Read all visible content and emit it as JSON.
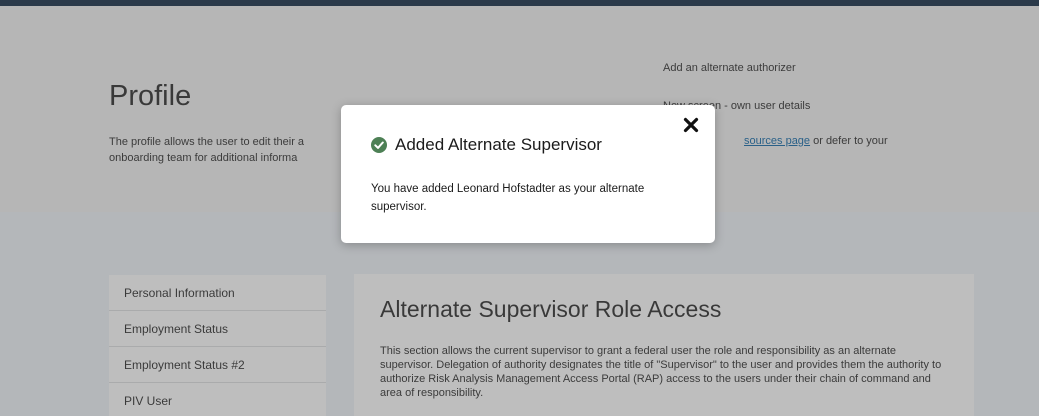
{
  "page": {
    "title": "Profile",
    "description": "The profile allows the user to edit their a\nonboarding team for additional informa",
    "right_links": {
      "link1": "Add an alternate authorizer",
      "link2": "New screen - own user details",
      "link3_anchor": "sources page",
      "link3_suffix": " or defer to your"
    }
  },
  "sidebar": {
    "items": [
      {
        "label": "Personal Information"
      },
      {
        "label": "Employment Status"
      },
      {
        "label": "Employment Status #2"
      },
      {
        "label": "PIV User"
      }
    ]
  },
  "section": {
    "title": "Alternate Supervisor Role Access",
    "body": "This section allows the current supervisor to grant a federal user the role and responsibility as an alternate supervisor. Delegation of authority designates the title of \"Supervisor\" to the user and provides them the authority to authorize Risk Analysis Management Access Portal (RAP) access to the users under their chain of command and area of responsibility."
  },
  "modal": {
    "title": "Added Alternate Supervisor",
    "body": "You have added Leonard Hofstadter as your alternate supervisor.",
    "icons": {
      "status": "check-circle-icon",
      "close": "close-icon"
    },
    "colors": {
      "success": "#4d8055"
    }
  }
}
